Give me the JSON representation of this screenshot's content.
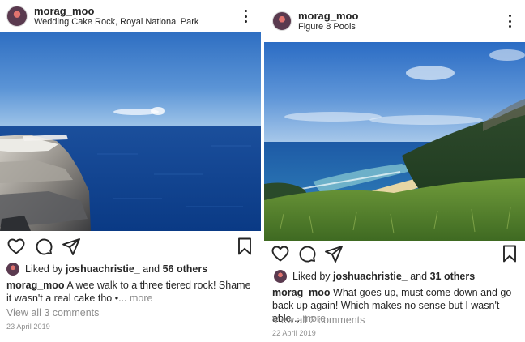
{
  "posts": [
    {
      "username": "morag_moo",
      "location": "Wedding Cake Rock, Royal National Park",
      "liked_by_prefix": "Liked by",
      "liked_by_user": "joshuachristie_",
      "liked_by_and": "and",
      "liked_by_others": "56 others",
      "caption_user": "morag_moo",
      "caption_text": "A wee walk to a three tiered rock! Shame it wasn't a real cake tho •...",
      "caption_more": "more",
      "view_comments": "View all 3 comments",
      "date": "23 April 2019",
      "photo_name": "wedding-cake-rock-ocean-cliff-photo"
    },
    {
      "username": "morag_moo",
      "location": "Figure 8 Pools",
      "liked_by_prefix": "Liked by",
      "liked_by_user": "joshuachristie_",
      "liked_by_and": "and",
      "liked_by_others": "31 others",
      "caption_user": "morag_moo",
      "caption_text": "What goes up, must come down and go back up again! Which makes no sense but I wasn't able...",
      "caption_more": "more",
      "view_comments": "View all 2 comments",
      "date": "22 April 2019",
      "photo_name": "figure-8-pools-coastline-photo"
    }
  ],
  "icons": {
    "more": "more-options-icon",
    "like": "heart-icon",
    "comment": "comment-icon",
    "share": "share-icon",
    "save": "bookmark-icon"
  },
  "colors": {
    "text": "#262626",
    "muted": "#8e8e8e",
    "sky": "#3f7fd0",
    "ocean": "#0b3f86"
  }
}
